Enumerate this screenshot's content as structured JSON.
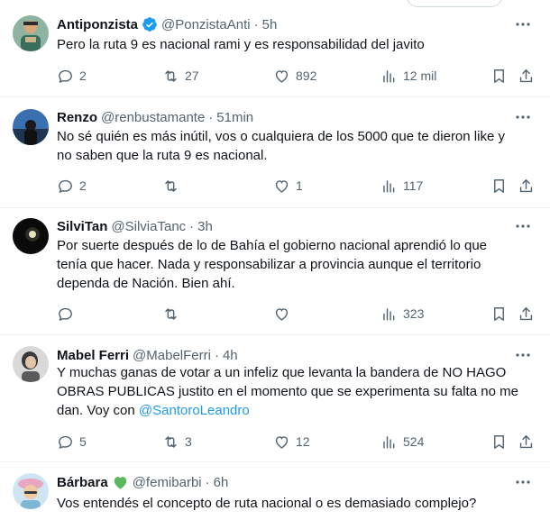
{
  "colors": {
    "text": "#0f1419",
    "secondary": "#536471",
    "accent": "#1d9bf0",
    "separator": "#eff3f4",
    "verified": "#1d9bf0",
    "heart_badge": "#4caf50"
  },
  "tweets": [
    {
      "name": "Antiponzista",
      "handle": "@PonzistaAnti",
      "sep": "·",
      "time": "5h",
      "verified": true,
      "text_lines": [
        "Pero la ruta 9 es nacional rami y es responsabilidad del javito"
      ],
      "replies": "2",
      "retweets": "27",
      "likes": "892",
      "views": "12 mil"
    },
    {
      "name": "Renzo",
      "handle": "@renbustamante",
      "sep": "·",
      "time": "51min",
      "text_lines": [
        "No sé quién es más inútil, vos o cualquiera de los 5000 que te dieron like y",
        "no saben que la ruta 9 es nacional."
      ],
      "replies": "2",
      "retweets": "",
      "likes": "1",
      "views": "117"
    },
    {
      "name": "SilviTan",
      "handle": "@SilviaTanc",
      "sep": "·",
      "time": "3h",
      "text_lines": [
        "Por suerte después de lo de Bahía el gobierno nacional aprendió lo que",
        "tenía que hacer. Nada y responsabilizar a provincia aunque el territorio",
        "dependa de Nación. Bien ahí."
      ],
      "replies": "",
      "retweets": "",
      "likes": "",
      "views": "323"
    },
    {
      "name": "Mabel Ferri",
      "handle": "@MabelFerri",
      "sep": "·",
      "time": "4h",
      "text_lines": [
        "Y muchas ganas de votar a un infeliz que levanta la bandera de NO HAGO",
        "OBRAS PUBLICAS justito en el momento que se experimenta su falta no me",
        "dan. Voy con "
      ],
      "mention": "@SantoroLeandro",
      "replies": "5",
      "retweets": "3",
      "likes": "12",
      "views": "524"
    },
    {
      "name": "Bárbara",
      "handle": "@femibarbi",
      "sep": "·",
      "time": "6h",
      "green_heart": true,
      "text_lines": [
        "Vos entendés el concepto de ruta nacional o es demasiado complejo?"
      ]
    }
  ]
}
